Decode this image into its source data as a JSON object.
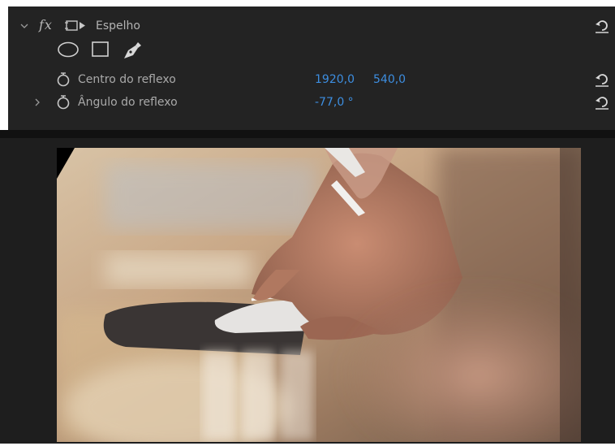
{
  "effect": {
    "name": "Espelho",
    "fx_label": "fx",
    "icons": {
      "twisty": "chevron-down-icon",
      "fx_toggle": "fx-toggle-icon",
      "reset": "reset-icon",
      "stopwatch": "stopwatch-icon",
      "mask_tools": [
        "ellipse-mask-icon",
        "rectangle-mask-icon",
        "pen-mask-icon"
      ]
    },
    "properties": [
      {
        "label": "Centro do reflexo",
        "value_x": "1920,0",
        "value_y": "540,0"
      },
      {
        "label": "Ângulo do reflexo",
        "value": "-77,0 °"
      }
    ]
  },
  "colors": {
    "panel_bg": "#232323",
    "value_blue": "#3d8ee0",
    "text_gray": "#a9a9a9"
  },
  "monitor": {
    "content": "video frame: hand over a white mouse on a dark mouse pad, mirrored"
  }
}
